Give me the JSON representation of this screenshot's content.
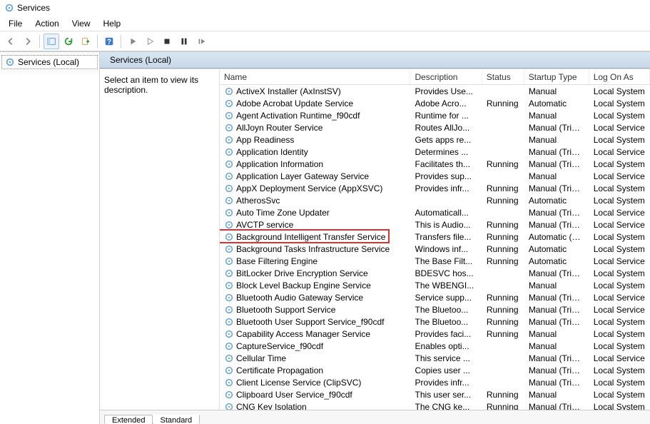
{
  "window": {
    "title": "Services"
  },
  "menu": {
    "file": "File",
    "action": "Action",
    "view": "View",
    "help": "Help"
  },
  "tree": {
    "root_label": "Services (Local)"
  },
  "detail": {
    "header": "Services (Local)",
    "desc_prompt": "Select an item to view its description."
  },
  "columns": {
    "name": "Name",
    "description": "Description",
    "status": "Status",
    "startup": "Startup Type",
    "logon": "Log On As"
  },
  "tabs": {
    "extended": "Extended",
    "standard": "Standard"
  },
  "highlighted_service": "Background Intelligent Transfer Service",
  "services": [
    {
      "name": "ActiveX Installer (AxInstSV)",
      "description": "Provides Use...",
      "status": "",
      "startup": "Manual",
      "logon": "Local System"
    },
    {
      "name": "Adobe Acrobat Update Service",
      "description": "Adobe Acro...",
      "status": "Running",
      "startup": "Automatic",
      "logon": "Local System"
    },
    {
      "name": "Agent Activation Runtime_f90cdf",
      "description": "Runtime for ...",
      "status": "",
      "startup": "Manual",
      "logon": "Local System"
    },
    {
      "name": "AllJoyn Router Service",
      "description": "Routes AllJo...",
      "status": "",
      "startup": "Manual (Trigg...",
      "logon": "Local Service"
    },
    {
      "name": "App Readiness",
      "description": "Gets apps re...",
      "status": "",
      "startup": "Manual",
      "logon": "Local System"
    },
    {
      "name": "Application Identity",
      "description": "Determines ...",
      "status": "",
      "startup": "Manual (Trigg...",
      "logon": "Local Service"
    },
    {
      "name": "Application Information",
      "description": "Facilitates th...",
      "status": "Running",
      "startup": "Manual (Trigg...",
      "logon": "Local System"
    },
    {
      "name": "Application Layer Gateway Service",
      "description": "Provides sup...",
      "status": "",
      "startup": "Manual",
      "logon": "Local Service"
    },
    {
      "name": "AppX Deployment Service (AppXSVC)",
      "description": "Provides infr...",
      "status": "Running",
      "startup": "Manual (Trigg...",
      "logon": "Local System"
    },
    {
      "name": "AtherosSvc",
      "description": "",
      "status": "Running",
      "startup": "Automatic",
      "logon": "Local System"
    },
    {
      "name": "Auto Time Zone Updater",
      "description": "Automaticall...",
      "status": "",
      "startup": "Manual (Trigg...",
      "logon": "Local Service"
    },
    {
      "name": "AVCTP service",
      "description": "This is Audio...",
      "status": "Running",
      "startup": "Manual (Trigg...",
      "logon": "Local Service"
    },
    {
      "name": "Background Intelligent Transfer Service",
      "description": "Transfers file...",
      "status": "Running",
      "startup": "Automatic (De...",
      "logon": "Local System"
    },
    {
      "name": "Background Tasks Infrastructure Service",
      "description": "Windows inf...",
      "status": "Running",
      "startup": "Automatic",
      "logon": "Local System"
    },
    {
      "name": "Base Filtering Engine",
      "description": "The Base Filt...",
      "status": "Running",
      "startup": "Automatic",
      "logon": "Local Service"
    },
    {
      "name": "BitLocker Drive Encryption Service",
      "description": "BDESVC hos...",
      "status": "",
      "startup": "Manual (Trigg...",
      "logon": "Local System"
    },
    {
      "name": "Block Level Backup Engine Service",
      "description": "The WBENGI...",
      "status": "",
      "startup": "Manual",
      "logon": "Local System"
    },
    {
      "name": "Bluetooth Audio Gateway Service",
      "description": "Service supp...",
      "status": "Running",
      "startup": "Manual (Trigg...",
      "logon": "Local Service"
    },
    {
      "name": "Bluetooth Support Service",
      "description": "The Bluetoo...",
      "status": "Running",
      "startup": "Manual (Trigg...",
      "logon": "Local Service"
    },
    {
      "name": "Bluetooth User Support Service_f90cdf",
      "description": "The Bluetoo...",
      "status": "Running",
      "startup": "Manual (Trigg...",
      "logon": "Local System"
    },
    {
      "name": "Capability Access Manager Service",
      "description": "Provides faci...",
      "status": "Running",
      "startup": "Manual",
      "logon": "Local System"
    },
    {
      "name": "CaptureService_f90cdf",
      "description": "Enables opti...",
      "status": "",
      "startup": "Manual",
      "logon": "Local System"
    },
    {
      "name": "Cellular Time",
      "description": "This service ...",
      "status": "",
      "startup": "Manual (Trigg...",
      "logon": "Local Service"
    },
    {
      "name": "Certificate Propagation",
      "description": "Copies user ...",
      "status": "",
      "startup": "Manual (Trigg...",
      "logon": "Local System"
    },
    {
      "name": "Client License Service (ClipSVC)",
      "description": "Provides infr...",
      "status": "",
      "startup": "Manual (Trigg...",
      "logon": "Local System"
    },
    {
      "name": "Clipboard User Service_f90cdf",
      "description": "This user ser...",
      "status": "Running",
      "startup": "Manual",
      "logon": "Local System"
    },
    {
      "name": "CNG Key Isolation",
      "description": "The CNG ke...",
      "status": "Running",
      "startup": "Manual (Trigg...",
      "logon": "Local System"
    }
  ]
}
